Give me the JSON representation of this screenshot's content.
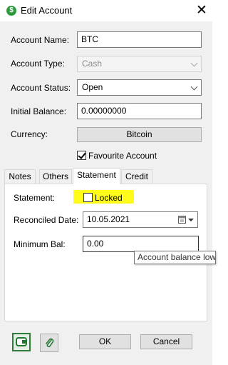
{
  "window": {
    "title": "Edit Account",
    "app_icon_glyph": "$",
    "close_glyph": "✕"
  },
  "form": {
    "account_name": {
      "label": "Account Name:",
      "value": "BTC"
    },
    "account_type": {
      "label": "Account Type:",
      "value": "Cash",
      "enabled": false
    },
    "account_status": {
      "label": "Account Status:",
      "value": "Open"
    },
    "initial_balance": {
      "label": "Initial Balance:",
      "value": "0.00000000"
    },
    "currency": {
      "label": "Currency:",
      "value": "Bitcoin"
    },
    "favourite": {
      "label": "Favourite Account",
      "checked": true
    }
  },
  "tabs": [
    {
      "label": "Notes",
      "active": false
    },
    {
      "label": "Others",
      "active": false
    },
    {
      "label": "Statement",
      "active": true
    },
    {
      "label": "Credit",
      "active": false
    }
  ],
  "statement": {
    "statement_label": "Statement:",
    "locked_label": "Locked",
    "locked_checked": false,
    "reconciled_date_label": "Reconciled Date:",
    "reconciled_date_value": "10.05.2021",
    "minimum_bal_label": "Minimum Bal:",
    "minimum_bal_value": "0.00",
    "tooltip": "Account balance low"
  },
  "footer": {
    "ok_label": "OK",
    "cancel_label": "Cancel",
    "left_icons": [
      "account-card-icon",
      "attachment-icon"
    ]
  },
  "colors": {
    "highlight": "#fffb1a",
    "app_icon": "#2e9a3e",
    "dialog_bg": "#f0f0f0"
  }
}
